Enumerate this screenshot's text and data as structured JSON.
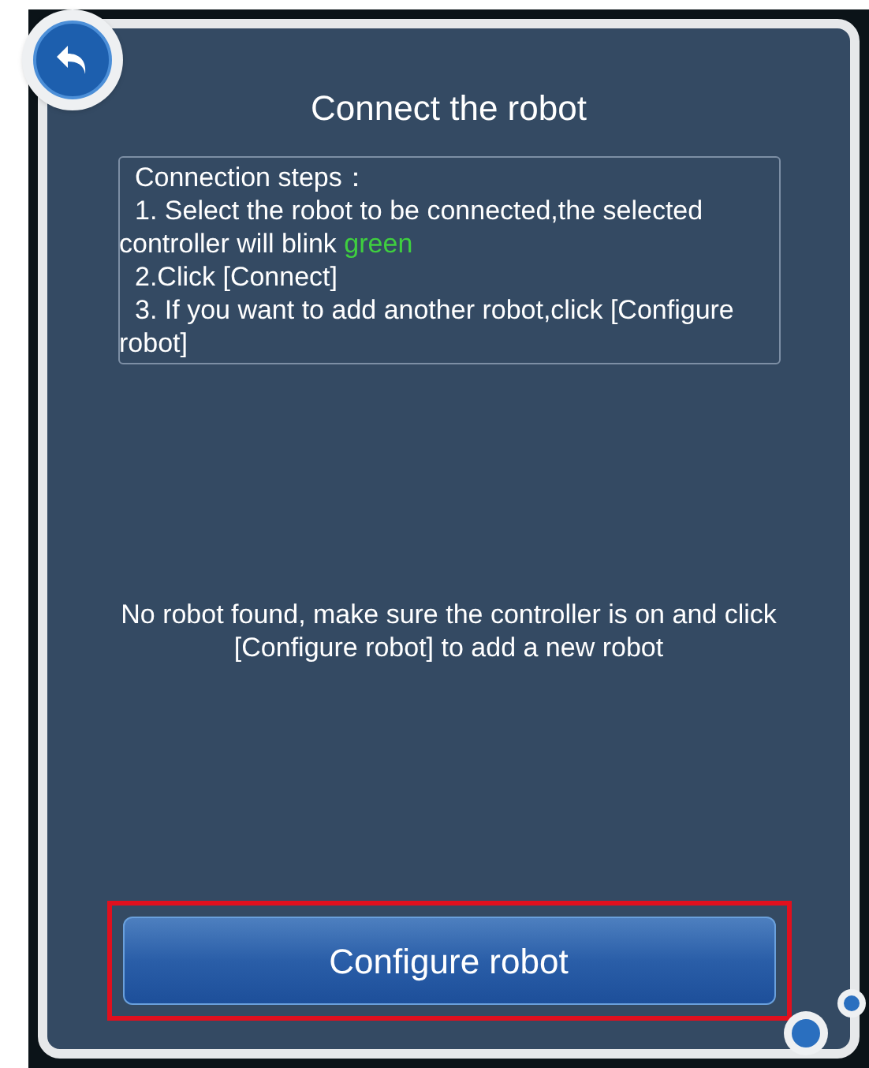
{
  "title": "Connect the robot",
  "steps": {
    "heading": "Connection steps：",
    "items": [
      {
        "text": "1. Select the robot to be connected,the selected controller will blink ",
        "accent": "green"
      },
      {
        "text": "2.Click [Connect]"
      },
      {
        "text": "3. If you want to add another robot,click [Configure robot]"
      }
    ]
  },
  "message": "No robot found, make sure the controller is on and click [Configure robot] to add a new robot",
  "button": {
    "label": "Configure robot",
    "highlighted": true
  }
}
